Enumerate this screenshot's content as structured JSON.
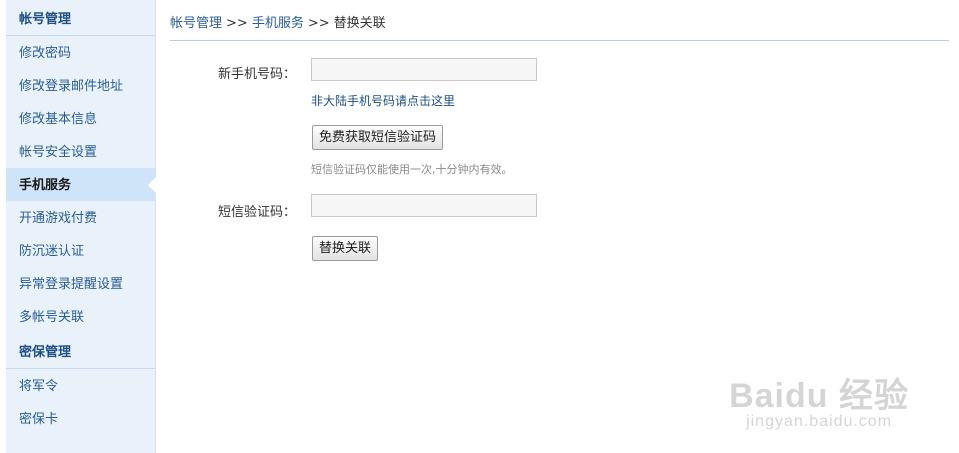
{
  "sidebar": {
    "section1_title": "帐号管理",
    "items": [
      {
        "label": "修改密码"
      },
      {
        "label": "修改登录邮件地址"
      },
      {
        "label": "修改基本信息"
      },
      {
        "label": "帐号安全设置"
      },
      {
        "label": "手机服务",
        "active": true
      },
      {
        "label": "开通游戏付费"
      },
      {
        "label": "防沉迷认证"
      },
      {
        "label": "异常登录提醒设置"
      },
      {
        "label": "多帐号关联"
      }
    ],
    "section2_title": "密保管理",
    "items2": [
      {
        "label": "将军令"
      },
      {
        "label": "密保卡"
      }
    ]
  },
  "breadcrumb": {
    "level1": "帐号管理",
    "sep1": ">>",
    "level2": "手机服务",
    "sep2": ">>",
    "current": "替换关联"
  },
  "form": {
    "phone_label": "新手机号码：",
    "phone_value": "",
    "non_mainland_link": "非大陆手机号码请点击这里",
    "get_code_button": "免费获取短信验证码",
    "code_hint": "短信验证码仅能使用一次,十分钟内有效。",
    "code_label": "短信验证码：",
    "code_value": "",
    "submit_button": "替换关联"
  },
  "watermark": {
    "logo_text": "Baidu 经验",
    "sub_text": "jingyan.baidu.com"
  },
  "colors": {
    "sidebar_bg": "#e9f2fb",
    "active_bg": "#cfe4f8",
    "link": "#2a5d93"
  }
}
